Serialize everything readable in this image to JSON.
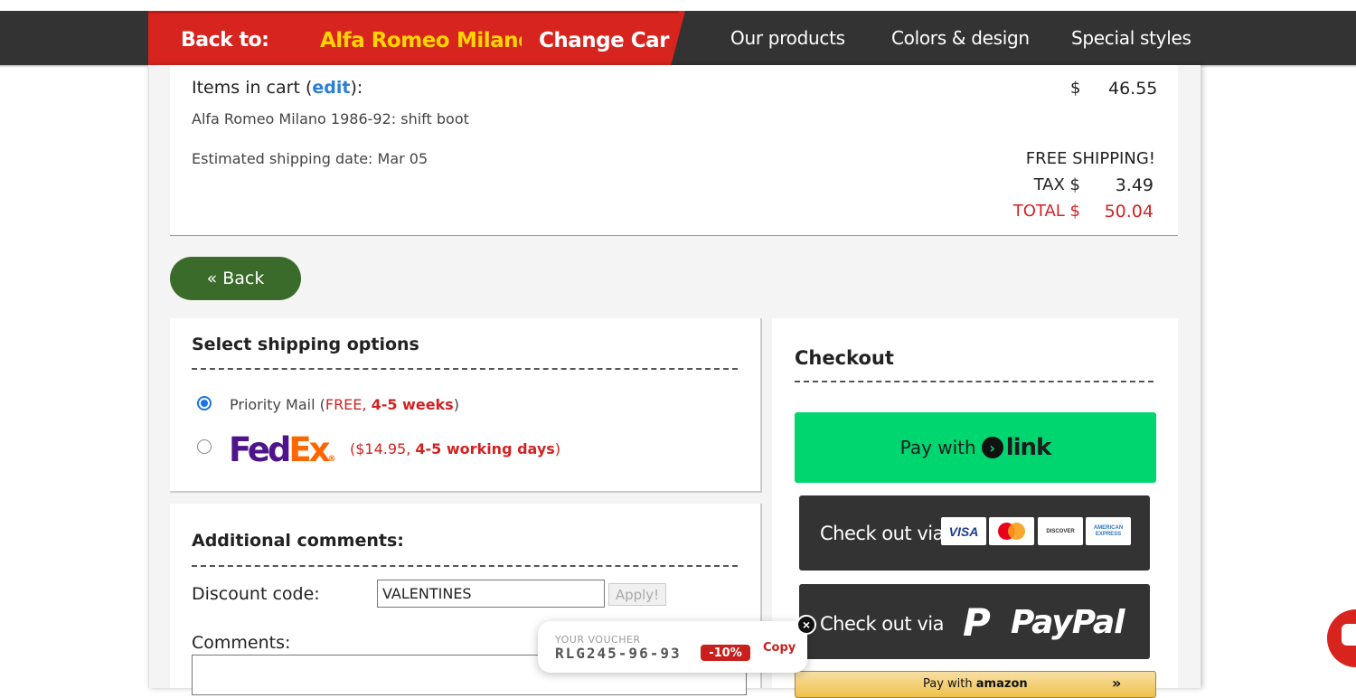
{
  "header": {
    "back_to_label": "Back to:",
    "make": "Alfa Romeo",
    "model": "Milano",
    "change_car": "Change Car",
    "nav": [
      "Our products",
      "Colors & design",
      "Special styles"
    ]
  },
  "cart": {
    "title_prefix": "Items in cart (",
    "edit_link": "edit",
    "title_suffix": "):",
    "item": "Alfa Romeo Milano 1986-92: shift boot",
    "estimated_shipping": "Estimated shipping date: Mar 05",
    "currency_symbol": "$",
    "item_price": "46.55",
    "free_shipping": "FREE SHIPPING!",
    "tax_label": "TAX $",
    "tax_value": "3.49",
    "total_label": "TOTAL $",
    "total_value": "50.04"
  },
  "back_button": "« Back",
  "shipping": {
    "title": "Select shipping options",
    "options": [
      {
        "name": "Priority Mail (",
        "price": "FREE, ",
        "time": "4-5 weeks",
        "close": ")",
        "selected": true
      },
      {
        "name": "FedEx",
        "price": "($14.95, ",
        "time": "4-5 working days",
        "close": ")",
        "selected": false
      }
    ],
    "fedex_fe": "Fed",
    "fedex_ex": "Ex",
    "fedex_reg": "®"
  },
  "comments": {
    "title": "Additional comments:",
    "discount_label": "Discount code:",
    "discount_value": "VALENTINES",
    "apply_button": "Apply!",
    "comments_label": "Comments:"
  },
  "checkout": {
    "title": "Checkout",
    "link_pay_with": "Pay with",
    "link_word": "link",
    "card_checkout": "Check out via",
    "cards": [
      "VISA",
      "mastercard",
      "DISCOVER",
      "AMERICAN EXPRESS"
    ],
    "paypal_checkout": "Check out via",
    "paypal_word": "PayPal",
    "amazon_prefix": "Pay with",
    "amazon_word": "amazon",
    "amazon_chevron": "»"
  },
  "voucher": {
    "label": "YOUR VOUCHER",
    "code": "RLG245-96-93",
    "discount": "-10%",
    "copy": "Copy"
  },
  "colors": {
    "header_bg": "#333333",
    "brand_red": "#d8241f",
    "brand_yellow": "#ffd400",
    "back_green": "#3a6b2a",
    "link_green": "#00d66f",
    "total_red": "#d32222"
  }
}
